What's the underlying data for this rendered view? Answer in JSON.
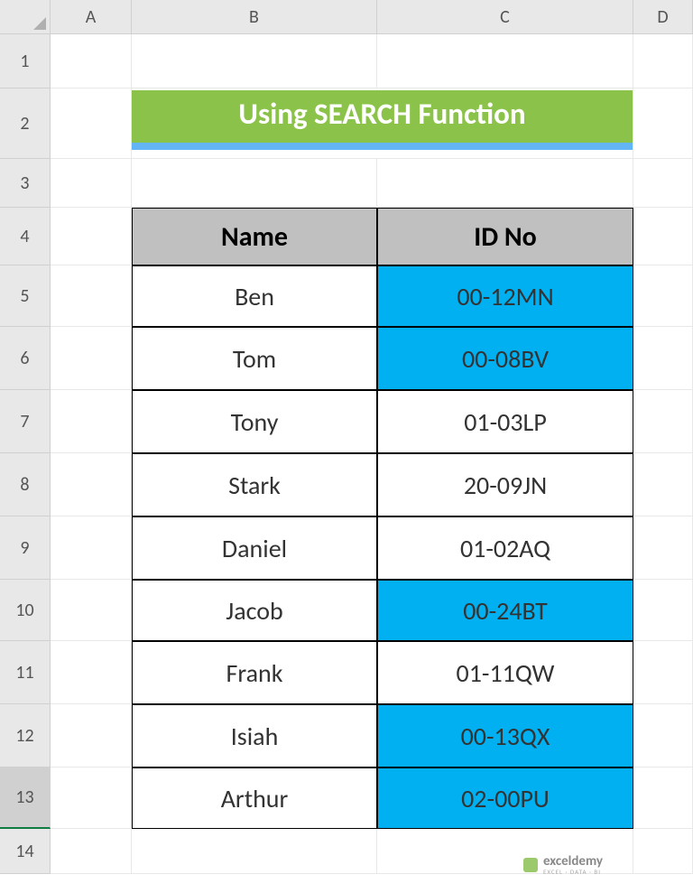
{
  "columns": [
    "A",
    "B",
    "C",
    "D"
  ],
  "rows": [
    "1",
    "2",
    "3",
    "4",
    "5",
    "6",
    "7",
    "8",
    "9",
    "10",
    "11",
    "12",
    "13",
    "14"
  ],
  "activeRow": 13,
  "title": "Using SEARCH Function",
  "tableHeaders": {
    "name": "Name",
    "id": "ID No"
  },
  "tableData": [
    {
      "name": "Ben",
      "id": "00-12MN",
      "highlighted": true
    },
    {
      "name": "Tom",
      "id": "00-08BV",
      "highlighted": true
    },
    {
      "name": "Tony",
      "id": "01-03LP",
      "highlighted": false
    },
    {
      "name": "Stark",
      "id": "20-09JN",
      "highlighted": false
    },
    {
      "name": "Daniel",
      "id": "01-02AQ",
      "highlighted": false
    },
    {
      "name": "Jacob",
      "id": "00-24BT",
      "highlighted": true
    },
    {
      "name": "Frank",
      "id": "01-11QW",
      "highlighted": false
    },
    {
      "name": "Isiah",
      "id": "00-13QX",
      "highlighted": true
    },
    {
      "name": "Arthur",
      "id": "02-00PU",
      "highlighted": true
    }
  ],
  "watermark": {
    "main": "exceldemy",
    "sub": "EXCEL · DATA · BI"
  },
  "colors": {
    "titleBg": "#8bc34a",
    "titleUnderline": "#64b5f6",
    "headerBg": "#c0c0c0",
    "highlight": "#00b0f0"
  }
}
